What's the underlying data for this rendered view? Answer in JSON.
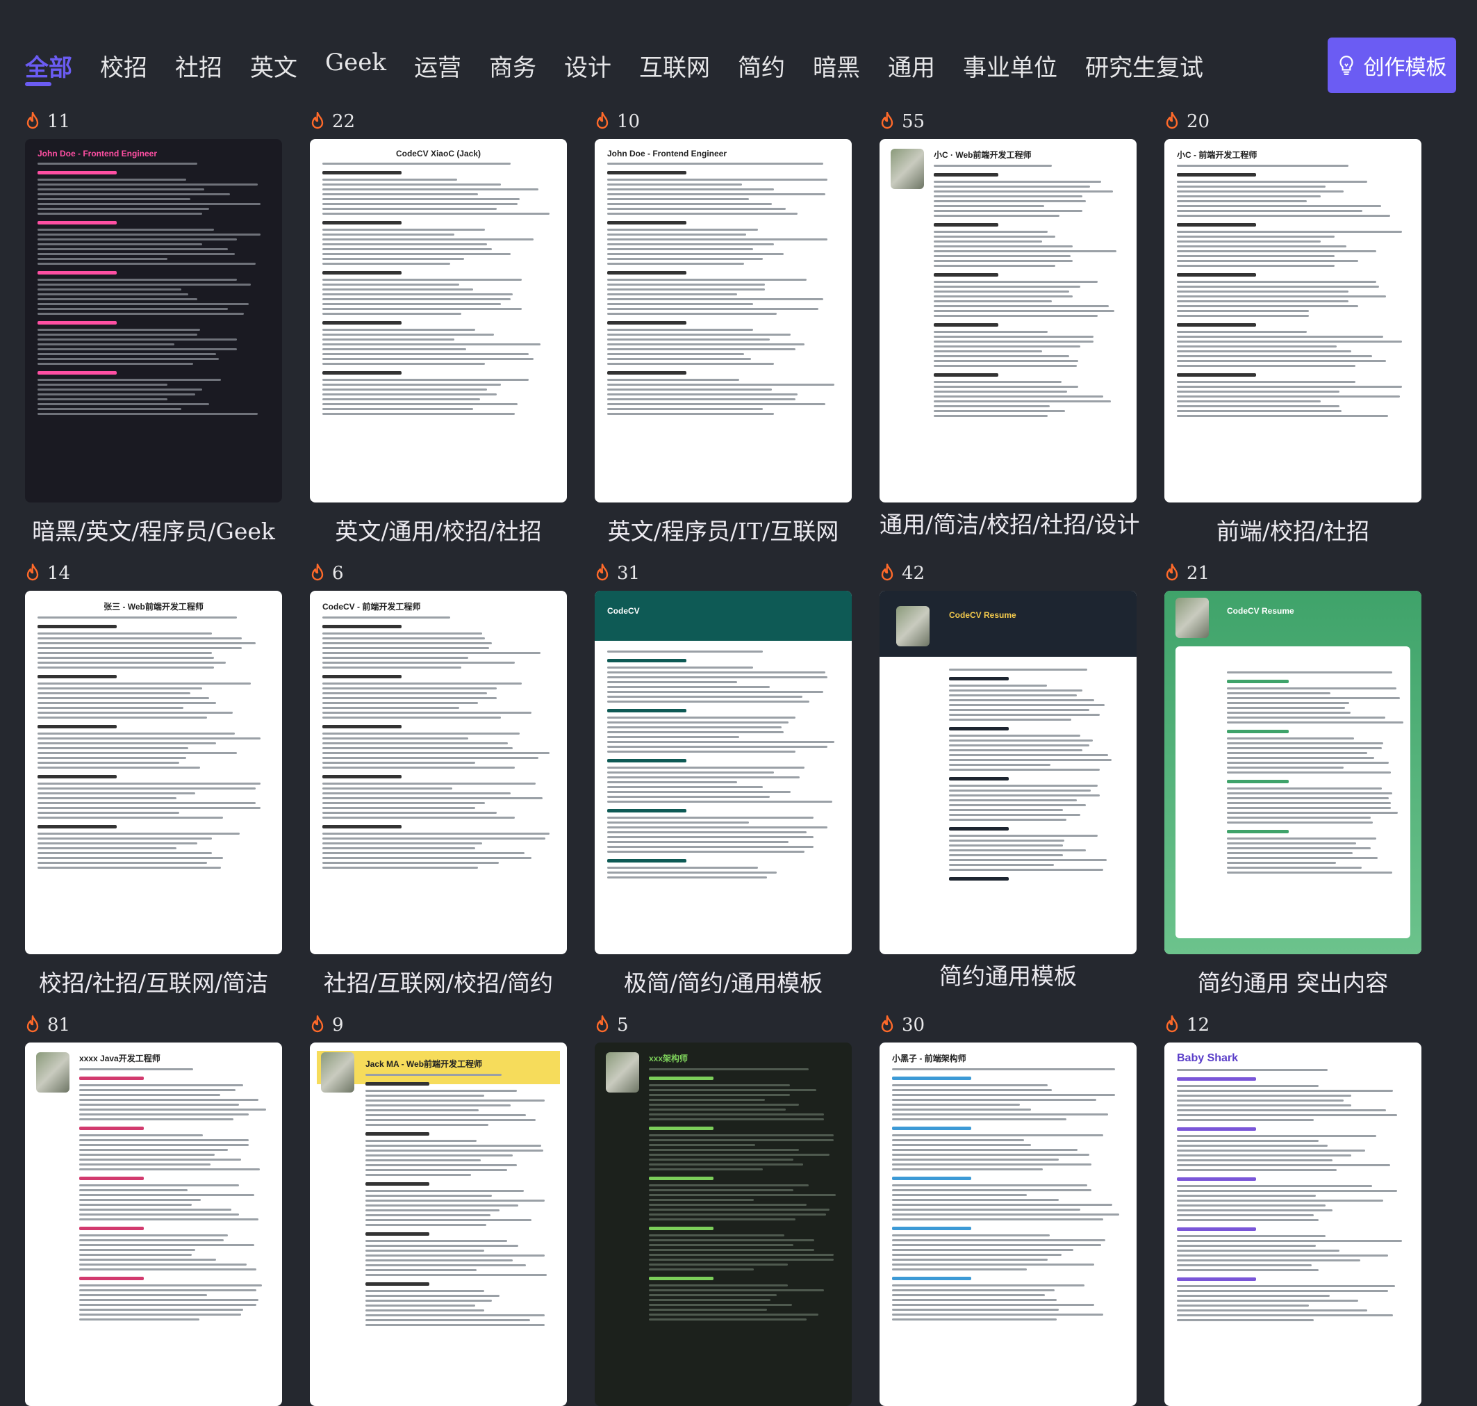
{
  "nav": {
    "tabs": [
      "全部",
      "校招",
      "社招",
      "英文",
      "Geek",
      "运营",
      "商务",
      "设计",
      "互联网",
      "简约",
      "暗黑",
      "通用",
      "事业单位",
      "研究生复试"
    ],
    "active_index": 0,
    "create_button": "创作模板"
  },
  "colors": {
    "accent": "#6b5cf3",
    "flame": "#ff6a2a",
    "background": "#25282f"
  },
  "templates": [
    {
      "heat": "11",
      "caption": "暗黑/英文/程序员/Geek",
      "title": "John Doe - Frontend Engineer",
      "style": "dark"
    },
    {
      "heat": "22",
      "caption": "英文/通用/校招/社招",
      "title": "CodeCV XiaoC (Jack)",
      "style": "plain-center"
    },
    {
      "heat": "10",
      "caption": "英文/程序员/IT/互联网",
      "title": "John Doe - Frontend Engineer",
      "style": "plain"
    },
    {
      "heat": "55",
      "caption": "通用/简洁/校招/社招/设计",
      "title": "小C · Web前端开发工程师",
      "style": "avatar"
    },
    {
      "heat": "20",
      "caption": "前端/校招/社招",
      "title": "小C - 前端开发工程师",
      "style": "plain"
    },
    {
      "heat": "14",
      "caption": "校招/社招/互联网/简洁",
      "title": "张三 - Web前端开发工程师",
      "style": "plain-center"
    },
    {
      "heat": "6",
      "caption": "社招/互联网/校招/简约",
      "title": "CodeCV - 前端开发工程师",
      "style": "plain"
    },
    {
      "heat": "31",
      "caption": "极简/简约/通用模板",
      "title": "CodeCV",
      "style": "teal"
    },
    {
      "heat": "42",
      "caption": "简约通用模板",
      "title": "CodeCV Resume",
      "style": "navy"
    },
    {
      "heat": "21",
      "caption": "简约通用 突出内容",
      "title": "CodeCV Resume",
      "style": "green"
    },
    {
      "heat": "81",
      "caption": "",
      "title": "xxxx Java开发工程师",
      "style": "avatar-pink"
    },
    {
      "heat": "9",
      "caption": "",
      "title": "Jack MA - Web前端开发工程师",
      "style": "yellow"
    },
    {
      "heat": "5",
      "caption": "",
      "title": "xxx架构师",
      "style": "darkgreen"
    },
    {
      "heat": "30",
      "caption": "",
      "title": "小黑子 - 前端架构师",
      "style": "blue-tags"
    },
    {
      "heat": "12",
      "caption": "",
      "title": "Baby Shark",
      "style": "purple"
    }
  ]
}
